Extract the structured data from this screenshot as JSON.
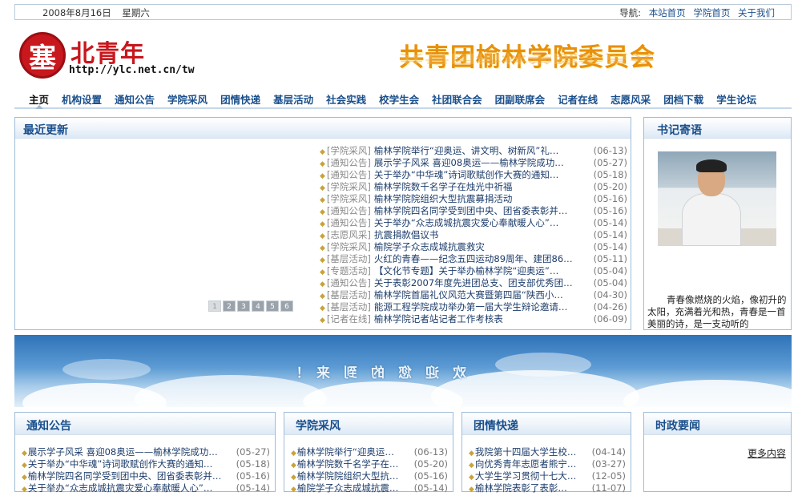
{
  "topbar": {
    "date": "2008年8月16日",
    "weekday": "星期六",
    "nav_label": "导航:",
    "links": [
      "本站首页",
      "学院首页",
      "关于我们"
    ]
  },
  "logo": {
    "mark": "塞",
    "name": "北青年",
    "url": "http://ylc.net.cn/tw"
  },
  "headline": "共青团榆林学院委员会",
  "nav": [
    "主页",
    "机构设置",
    "通知公告",
    "学院采风",
    "团情快递",
    "基层活动",
    "社会实践",
    "校学生会",
    "社团联合会",
    "团副联席会",
    "记者在线",
    "志愿风采",
    "团档下载",
    "学生论坛"
  ],
  "recent": {
    "title": "最近更新",
    "pages": [
      "1",
      "2",
      "3",
      "4",
      "5",
      "6"
    ],
    "items": [
      {
        "cat": "[学院采风]",
        "title": "榆林学院举行“迎奥运、讲文明、树新风”礼…",
        "date": "(06-13)"
      },
      {
        "cat": "[通知公告]",
        "title": "展示学子风采 喜迎08奥运——榆林学院成功…",
        "date": "(05-27)"
      },
      {
        "cat": "[通知公告]",
        "title": "关于举办“中华魂”诗词歌赋创作大赛的通知…",
        "date": "(05-18)"
      },
      {
        "cat": "[学院采风]",
        "title": "榆林学院数千名学子在烛光中祈福",
        "date": "(05-20)"
      },
      {
        "cat": "[学院采风]",
        "title": "榆林学院院组织大型抗震募捐活动",
        "date": "(05-16)"
      },
      {
        "cat": "[通知公告]",
        "title": "榆林学院四名同学受到团中央、团省委表彰并…",
        "date": "(05-16)"
      },
      {
        "cat": "[通知公告]",
        "title": "关于举办“众志成城抗震灾爱心奉献暖人心”…",
        "date": "(05-14)"
      },
      {
        "cat": "[志愿风采]",
        "title": "抗震捐款倡议书",
        "date": "(05-14)"
      },
      {
        "cat": "[学院采风]",
        "title": "榆院学子众志成城抗震救灾",
        "date": "(05-14)"
      },
      {
        "cat": "[基层活动]",
        "title": "火红的青春——纪念五四运动89周年、建团86…",
        "date": "(05-11)"
      },
      {
        "cat": "[专题活动]",
        "title": "【文化节专题】关于举办榆林学院“迎奥运”…",
        "date": "(05-04)"
      },
      {
        "cat": "[通知公告]",
        "title": "关于表彰2007年度先进团总支、团支部优秀团…",
        "date": "(05-04)"
      },
      {
        "cat": "[基层活动]",
        "title": "榆林学院首届礼仪风范大赛暨第四届“陕西小…",
        "date": "(04-30)"
      },
      {
        "cat": "[基层活动]",
        "title": "能源工程学院成功举办第一届大学生辩论邀请…",
        "date": "(04-26)"
      },
      {
        "cat": "[记者在线]",
        "title": "榆林学院记者站记者工作考核表",
        "date": "(06-09)"
      }
    ]
  },
  "secretary": {
    "title": "书记寄语",
    "text": "青春像燃烧的火焰，像初升的太阳，充满着光和热，青春是一首美丽的诗，是一支动听的"
  },
  "banner": {
    "text": "欢迎您的到来！"
  },
  "notice": {
    "title": "通知公告",
    "items": [
      {
        "title": "展示学子风采 喜迎08奥运——榆林学院成功…",
        "date": "(05-27)"
      },
      {
        "title": "关于举办“中华魂”诗词歌赋创作大赛的通知…",
        "date": "(05-18)"
      },
      {
        "title": "榆林学院四名同学受到团中央、团省委表彰并…",
        "date": "(05-16)"
      },
      {
        "title": "关于举办“众志成城抗震灾爱心奉献暖人心”…",
        "date": "(05-14)"
      }
    ]
  },
  "college": {
    "title": "学院采风",
    "items": [
      {
        "title": "榆林学院举行“迎奥运…",
        "date": "(06-13)"
      },
      {
        "title": "榆林学院数千名学子在…",
        "date": "(05-20)"
      },
      {
        "title": "榆林学院院组织大型抗…",
        "date": "(05-16)"
      },
      {
        "title": "榆院学子众志成城抗震…",
        "date": "(05-14)"
      }
    ]
  },
  "league": {
    "title": "团情快递",
    "items": [
      {
        "title": "我院第十四届大学生校…",
        "date": "(04-14)"
      },
      {
        "title": "向优秀青年志愿者熊宁…",
        "date": "(03-27)"
      },
      {
        "title": "大学生学习贯彻十七大…",
        "date": "(12-05)"
      },
      {
        "title": "榆林学院表彰了表彰…",
        "date": "(11-07)"
      }
    ]
  },
  "politics": {
    "title": "时政要闻",
    "more": "更多内容"
  }
}
